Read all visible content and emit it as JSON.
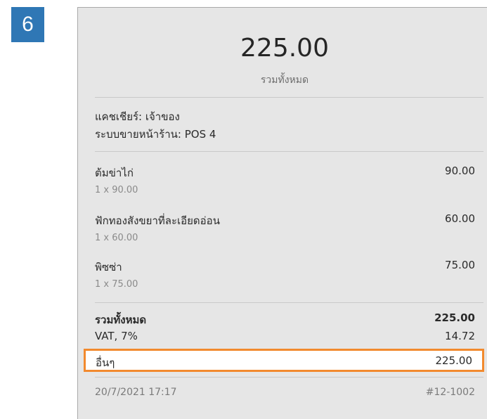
{
  "step": {
    "number": "6"
  },
  "colors": {
    "badge": "#2f77b5",
    "highlight": "#f28a2e",
    "receipt_bg": "#e6e6e6"
  },
  "receipt": {
    "total_value": "225.00",
    "total_caption": "รวมทั้งหมด",
    "cashier": "แคชเชียร์: เจ้าของ",
    "pos": "ระบบขายหน้าร้าน: POS 4",
    "items": [
      {
        "name": "ต้มข่าไก่",
        "detail": "1 x 90.00",
        "amount": "90.00"
      },
      {
        "name": "ฟักทองสังขยาที่ละเอียดอ่อน",
        "detail": "1 x 60.00",
        "amount": "60.00"
      },
      {
        "name": "พิซซ่า",
        "detail": "1 x 75.00",
        "amount": "75.00"
      }
    ],
    "summary": {
      "total_label": "รวมทั้งหมด",
      "total_amount": "225.00",
      "vat_label": "VAT, 7%",
      "vat_amount": "14.72",
      "other_label": "อื่นๆ",
      "other_amount": "225.00"
    },
    "footer": {
      "datetime": "20/7/2021 17:17",
      "receipt_number": "#12-1002"
    }
  }
}
